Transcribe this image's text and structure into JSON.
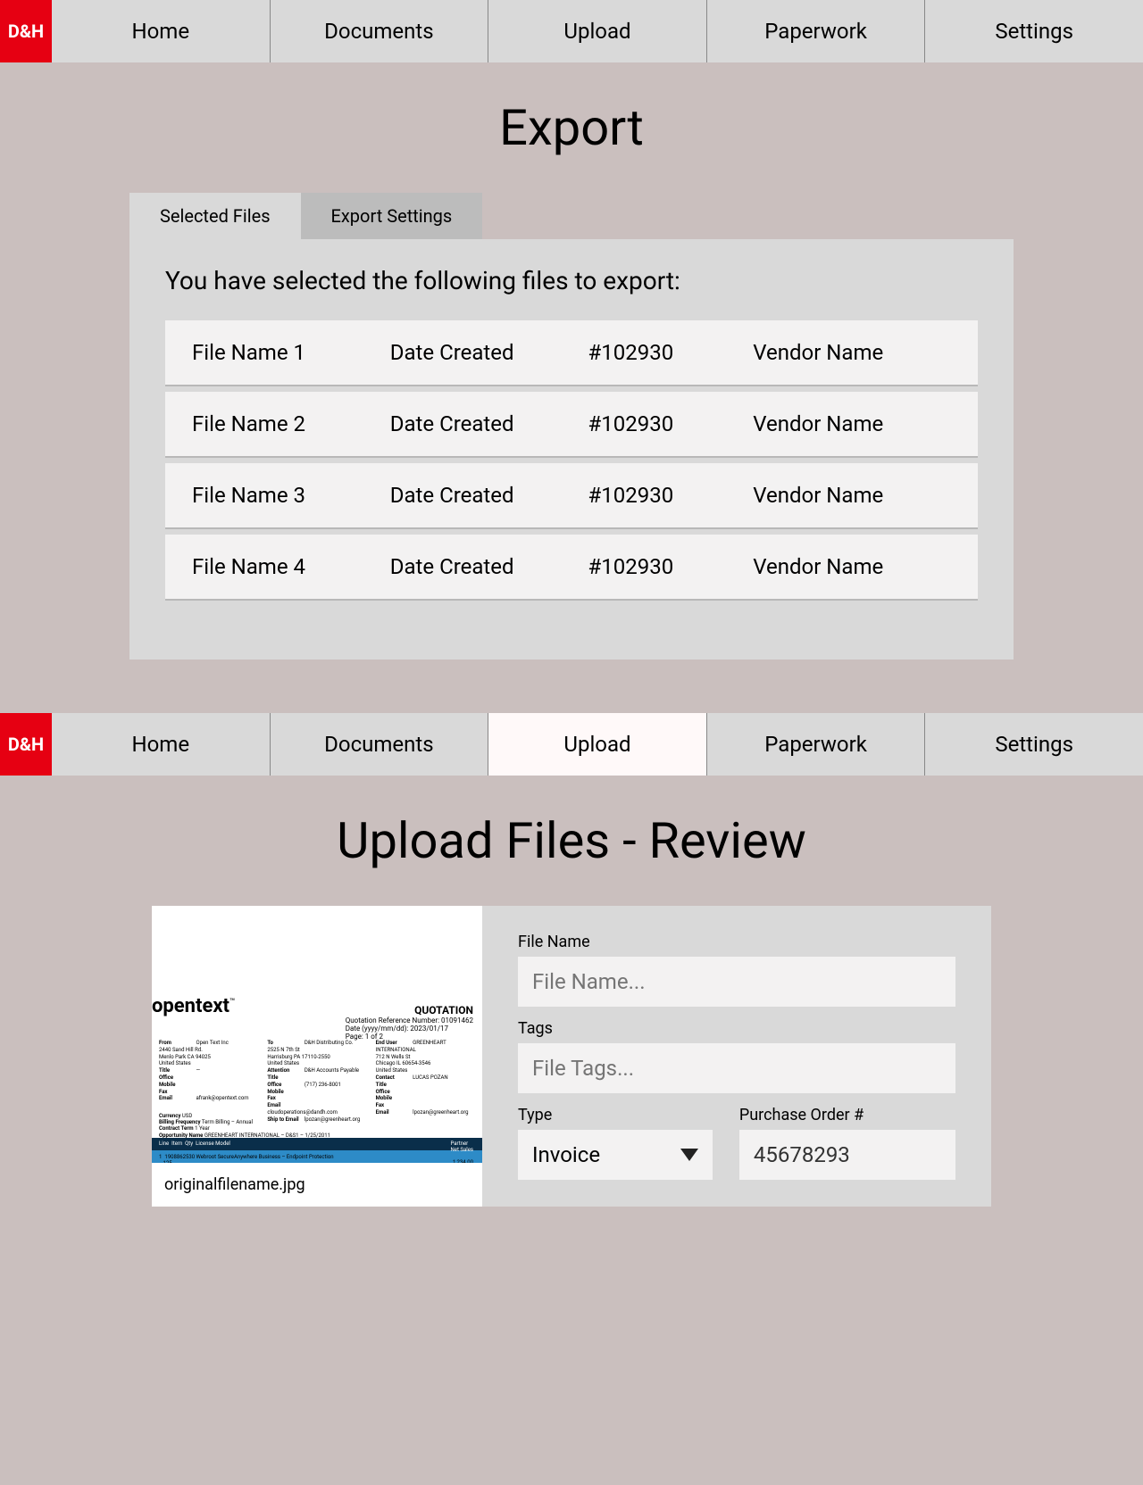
{
  "logo_text": "D&H",
  "nav": {
    "items": [
      "Home",
      "Documents",
      "Upload",
      "Paperwork",
      "Settings"
    ]
  },
  "export_screen": {
    "title": "Export",
    "tabs": {
      "selected": "Selected Files",
      "other": "Export Settings"
    },
    "intro": "You have selected the following files to export:",
    "files": [
      {
        "name": "File Name 1",
        "date": "Date Created",
        "num": "#102930",
        "vendor": "Vendor Name"
      },
      {
        "name": "File Name 2",
        "date": "Date Created",
        "num": "#102930",
        "vendor": "Vendor Name"
      },
      {
        "name": "File Name 3",
        "date": "Date Created",
        "num": "#102930",
        "vendor": "Vendor Name"
      },
      {
        "name": "File Name 4",
        "date": "Date Created",
        "num": "#102930",
        "vendor": "Vendor Name"
      }
    ]
  },
  "upload_screen": {
    "title": "Upload Files - Review",
    "preview_caption": "originalfilename.jpg",
    "doc": {
      "brand": "opentext",
      "heading": "QUOTATION",
      "ref": "Quotation Reference Number: 01091462",
      "date": "Date (yyyy/mm/dd): 2023/01/17",
      "page": "Page: 1 of 2"
    },
    "form": {
      "file_name_label": "File Name",
      "file_name_placeholder": "File Name...",
      "tags_label": "Tags",
      "tags_placeholder": "File Tags...",
      "type_label": "Type",
      "type_value": "Invoice",
      "po_label": "Purchase Order #",
      "po_value": "45678293"
    }
  }
}
